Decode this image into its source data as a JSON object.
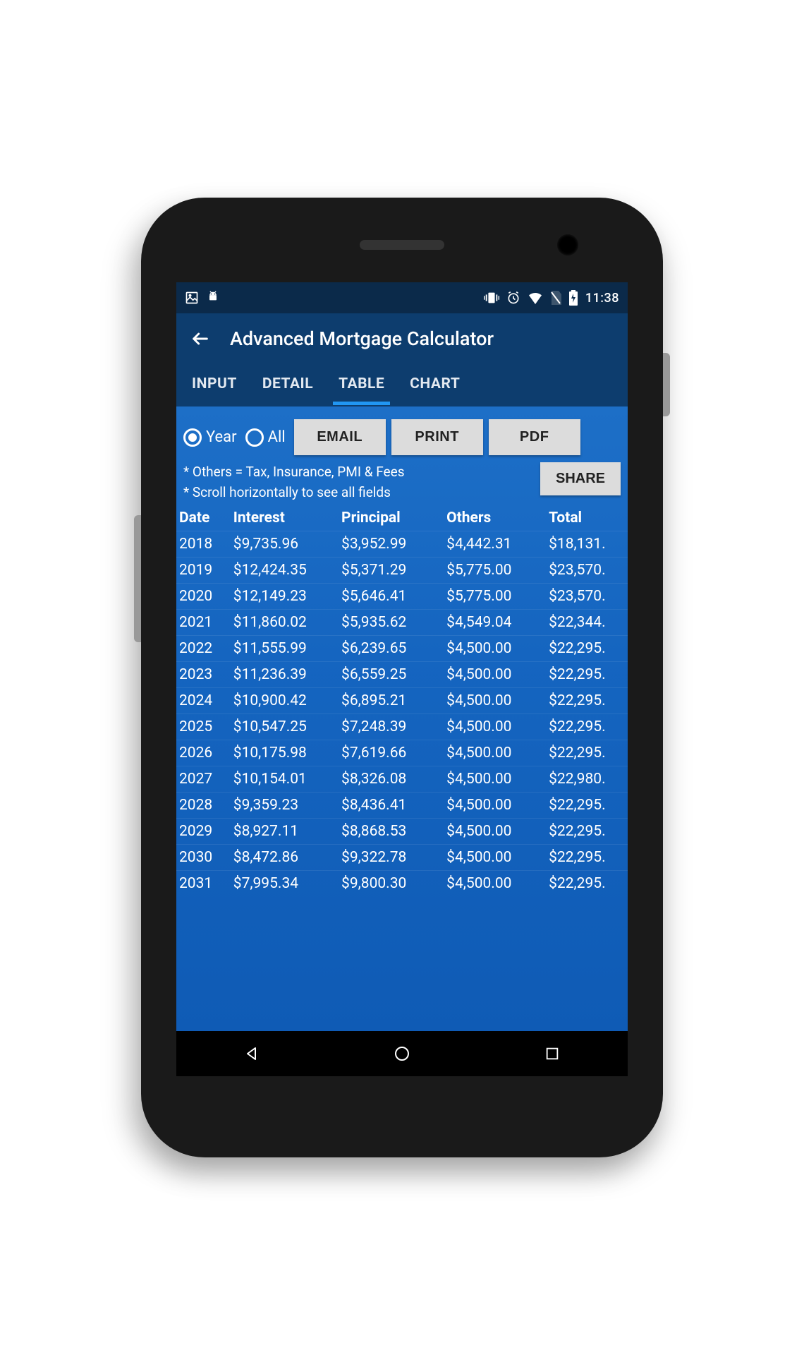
{
  "status_bar": {
    "time": "11:38"
  },
  "app_bar": {
    "title": "Advanced Mortgage Calculator"
  },
  "tabs": {
    "input": "INPUT",
    "detail": "DETAIL",
    "table": "TABLE",
    "chart": "CHART",
    "active": "table"
  },
  "controls": {
    "radio_year": "Year",
    "radio_all": "All",
    "radio_selected": "year",
    "email": "EMAIL",
    "print": "PRINT",
    "pdf": "PDF",
    "share": "SHARE"
  },
  "notes": {
    "line1": "* Others = Tax, Insurance, PMI & Fees",
    "line2": "* Scroll horizontally to see all fields"
  },
  "table": {
    "headers": {
      "date": "Date",
      "interest": "Interest",
      "principal": "Principal",
      "others": "Others",
      "total": "Total"
    },
    "rows": [
      {
        "date": "2018",
        "interest": "$9,735.96",
        "principal": "$3,952.99",
        "others": "$4,442.31",
        "total": "$18,131."
      },
      {
        "date": "2019",
        "interest": "$12,424.35",
        "principal": "$5,371.29",
        "others": "$5,775.00",
        "total": "$23,570."
      },
      {
        "date": "2020",
        "interest": "$12,149.23",
        "principal": "$5,646.41",
        "others": "$5,775.00",
        "total": "$23,570."
      },
      {
        "date": "2021",
        "interest": "$11,860.02",
        "principal": "$5,935.62",
        "others": "$4,549.04",
        "total": "$22,344."
      },
      {
        "date": "2022",
        "interest": "$11,555.99",
        "principal": "$6,239.65",
        "others": "$4,500.00",
        "total": "$22,295."
      },
      {
        "date": "2023",
        "interest": "$11,236.39",
        "principal": "$6,559.25",
        "others": "$4,500.00",
        "total": "$22,295."
      },
      {
        "date": "2024",
        "interest": "$10,900.42",
        "principal": "$6,895.21",
        "others": "$4,500.00",
        "total": "$22,295."
      },
      {
        "date": "2025",
        "interest": "$10,547.25",
        "principal": "$7,248.39",
        "others": "$4,500.00",
        "total": "$22,295."
      },
      {
        "date": "2026",
        "interest": "$10,175.98",
        "principal": "$7,619.66",
        "others": "$4,500.00",
        "total": "$22,295."
      },
      {
        "date": "2027",
        "interest": "$10,154.01",
        "principal": "$8,326.08",
        "others": "$4,500.00",
        "total": "$22,980."
      },
      {
        "date": "2028",
        "interest": "$9,359.23",
        "principal": "$8,436.41",
        "others": "$4,500.00",
        "total": "$22,295."
      },
      {
        "date": "2029",
        "interest": "$8,927.11",
        "principal": "$8,868.53",
        "others": "$4,500.00",
        "total": "$22,295."
      },
      {
        "date": "2030",
        "interest": "$8,472.86",
        "principal": "$9,322.78",
        "others": "$4,500.00",
        "total": "$22,295."
      },
      {
        "date": "2031",
        "interest": "$7,995.34",
        "principal": "$9,800.30",
        "others": "$4,500.00",
        "total": "$22,295."
      }
    ]
  }
}
